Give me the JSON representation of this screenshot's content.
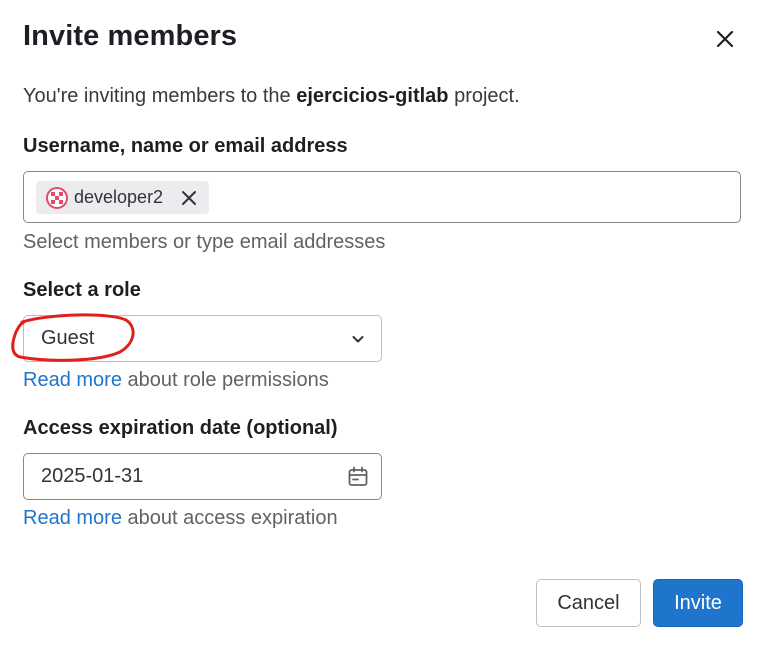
{
  "modal": {
    "title": "Invite members",
    "intro_prefix": "You're inviting members to the ",
    "project_name": "ejercicios-gitlab",
    "intro_suffix": " project."
  },
  "members_field": {
    "label": "Username, name or email address",
    "tokens": [
      {
        "username": "developer2"
      }
    ],
    "help_text": "Select members or type email addresses"
  },
  "role_field": {
    "label": "Select a role",
    "selected_value": "Guest",
    "help_link": "Read more",
    "help_text": " about role permissions"
  },
  "expiration_field": {
    "label": "Access expiration date (optional)",
    "value": "2025-01-31",
    "help_link": "Read more",
    "help_text": " about access expiration"
  },
  "footer": {
    "cancel_label": "Cancel",
    "invite_label": "Invite"
  },
  "colors": {
    "primary": "#1f75cb",
    "annotation": "#e0201c",
    "avatar_border": "#e24b6b"
  },
  "icons": {
    "close": "close-icon",
    "token_remove": "close-icon",
    "select": "chevron-down-icon",
    "date": "calendar-icon"
  }
}
